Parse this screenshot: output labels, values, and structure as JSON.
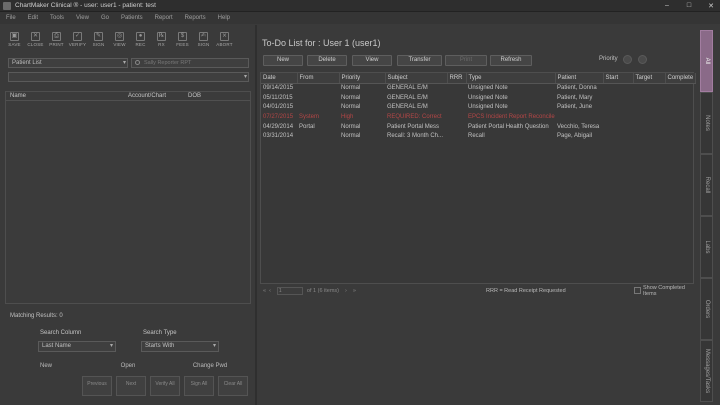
{
  "window": {
    "title": "ChartMaker Clinical ® - user: user1 - patient: test",
    "min": "–",
    "max": "□",
    "close": "✕"
  },
  "menu": [
    "File",
    "Edit",
    "Tools",
    "View",
    "Go",
    "Patients",
    "Report",
    "Reports",
    "Help"
  ],
  "toolbar": [
    {
      "label": "SAVE",
      "icon": "save-icon",
      "glyph": "▣"
    },
    {
      "label": "CLOSE",
      "icon": "close-icon",
      "glyph": "✕"
    },
    {
      "label": "PRINT",
      "icon": "print-icon",
      "glyph": "⎙"
    },
    {
      "label": "VERIFY",
      "icon": "verify-icon",
      "glyph": "✓"
    },
    {
      "label": "SIGN",
      "icon": "sign-icon",
      "glyph": "✎"
    },
    {
      "label": "VIEW",
      "icon": "view-icon",
      "glyph": "◎"
    },
    {
      "label": "REC",
      "icon": "record-icon",
      "glyph": "●"
    },
    {
      "label": "RX",
      "icon": "rx-icon",
      "glyph": "℞"
    },
    {
      "label": "FEES",
      "icon": "fees-icon",
      "glyph": "$"
    },
    {
      "label": "SIGN",
      "icon": "signature-icon",
      "glyph": "✍"
    },
    {
      "label": "ABORT",
      "icon": "abort-icon",
      "glyph": "⨯"
    }
  ],
  "left": {
    "patient_list_select": "Patient List",
    "search_placeholder": "Sally Reporter RPT",
    "second_select": "",
    "columns": [
      "Name",
      "Account/Chart",
      "DOB"
    ],
    "matching": "Matching Results: 0",
    "search_column_label": "Search Column",
    "search_column_value": "Last Name",
    "search_type_label": "Search Type",
    "search_type_value": "Starts With",
    "actions": [
      "New",
      "Open",
      "Change Pwd"
    ],
    "bottom_buttons": [
      "Previous",
      "Next",
      "Verify All",
      "Sign All",
      "Clear All"
    ]
  },
  "todo": {
    "title": "To-Do List for : User 1 (user1)",
    "buttons": {
      "new": "New",
      "delete": "Delete",
      "view": "View",
      "transfer": "Transfer",
      "print": "Print",
      "refresh": "Refresh"
    },
    "priority_label": "Priority",
    "columns": [
      "Date",
      "From",
      "Priority",
      "Subject",
      "RRR",
      "Type",
      "Patient",
      "Start",
      "Target",
      "Complete"
    ],
    "rows": [
      {
        "date": "09/14/2015",
        "from": "",
        "priority": "Normal",
        "subject": "GENERAL E/M",
        "rrr": "",
        "type": "Unsigned Note",
        "patient": "Patient, Donna",
        "alert": false
      },
      {
        "date": "05/11/2015",
        "from": "",
        "priority": "Normal",
        "subject": "GENERAL E/M",
        "rrr": "",
        "type": "Unsigned Note",
        "patient": "Patient, Mary",
        "alert": false
      },
      {
        "date": "04/01/2015",
        "from": "",
        "priority": "Normal",
        "subject": "GENERAL E/M",
        "rrr": "",
        "type": "Unsigned Note",
        "patient": "Patient, June",
        "alert": false
      },
      {
        "date": "07/27/2015",
        "from": "System",
        "priority": "High",
        "subject": "REQUIRED: Correct",
        "rrr": "",
        "type": "EPCS Incident Report Reconciler",
        "patient": "",
        "alert": true
      },
      {
        "date": "04/29/2014",
        "from": "Portal",
        "priority": "Normal",
        "subject": "Patient Portal Mess",
        "rrr": "",
        "type": "Patient Portal Health Question",
        "patient": "Vecchio, Teresa",
        "alert": false
      },
      {
        "date": "03/31/2014",
        "from": "",
        "priority": "Normal",
        "subject": "Recall: 3 Month Ch...",
        "rrr": "",
        "type": "Recall",
        "patient": "Page, Abigail",
        "alert": false
      }
    ],
    "pager": {
      "page": "1",
      "of": "of 1 (6 items)",
      "first": "«",
      "prev": "‹",
      "next": "›",
      "last": "»"
    },
    "rrr_note": "RRR = Read Receipt Requested",
    "show_completed": "Show Completed Items"
  },
  "sidetabs": [
    "All",
    "Notes",
    "Recall",
    "Labs",
    "Orders",
    "Messages/Tasks"
  ]
}
